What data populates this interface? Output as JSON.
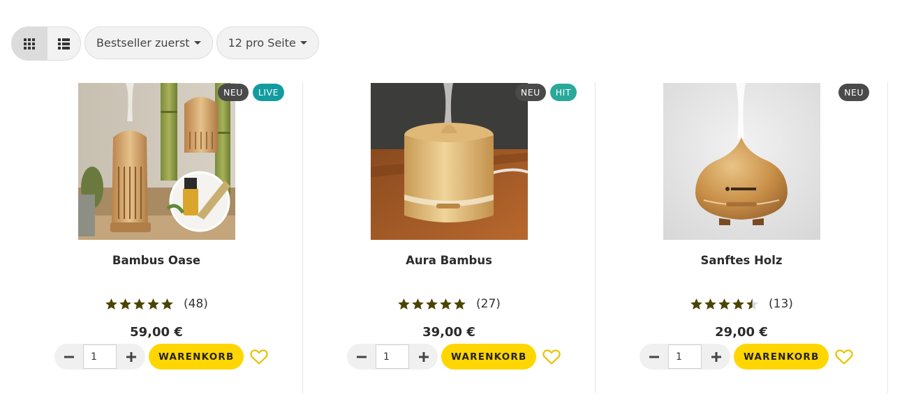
{
  "toolbar": {
    "sort_label": "Bestseller zuerst",
    "per_page_label": "12 pro Seite"
  },
  "products": [
    {
      "title": "Bambus Oase",
      "badges": [
        "NEU",
        "LIVE"
      ],
      "rating": 5,
      "rating_count": "(48)",
      "price": "59,00 €",
      "quantity": "1",
      "cart_label": "WARENKORB"
    },
    {
      "title": "Aura Bambus",
      "badges": [
        "NEU",
        "HIT"
      ],
      "rating": 5,
      "rating_count": "(27)",
      "price": "39,00 €",
      "quantity": "1",
      "cart_label": "WARENKORB"
    },
    {
      "title": "Sanftes Holz",
      "badges": [
        "NEU"
      ],
      "rating": 4.5,
      "rating_count": "(13)",
      "price": "29,00 €",
      "quantity": "1",
      "cart_label": "WARENKORB"
    }
  ],
  "colors": {
    "cart_button": "#ffd600",
    "star": "#4d4300",
    "badge_neu": "#4a4a4a",
    "badge_live": "#129ca0",
    "badge_hit": "#2aa89a",
    "wishlist_heart": "#e8c200"
  },
  "icons": {
    "grid_view": "grid-icon",
    "list_view": "list-icon",
    "minus": "minus-icon",
    "plus": "plus-icon",
    "wishlist": "heart-icon",
    "star": "star-icon"
  }
}
